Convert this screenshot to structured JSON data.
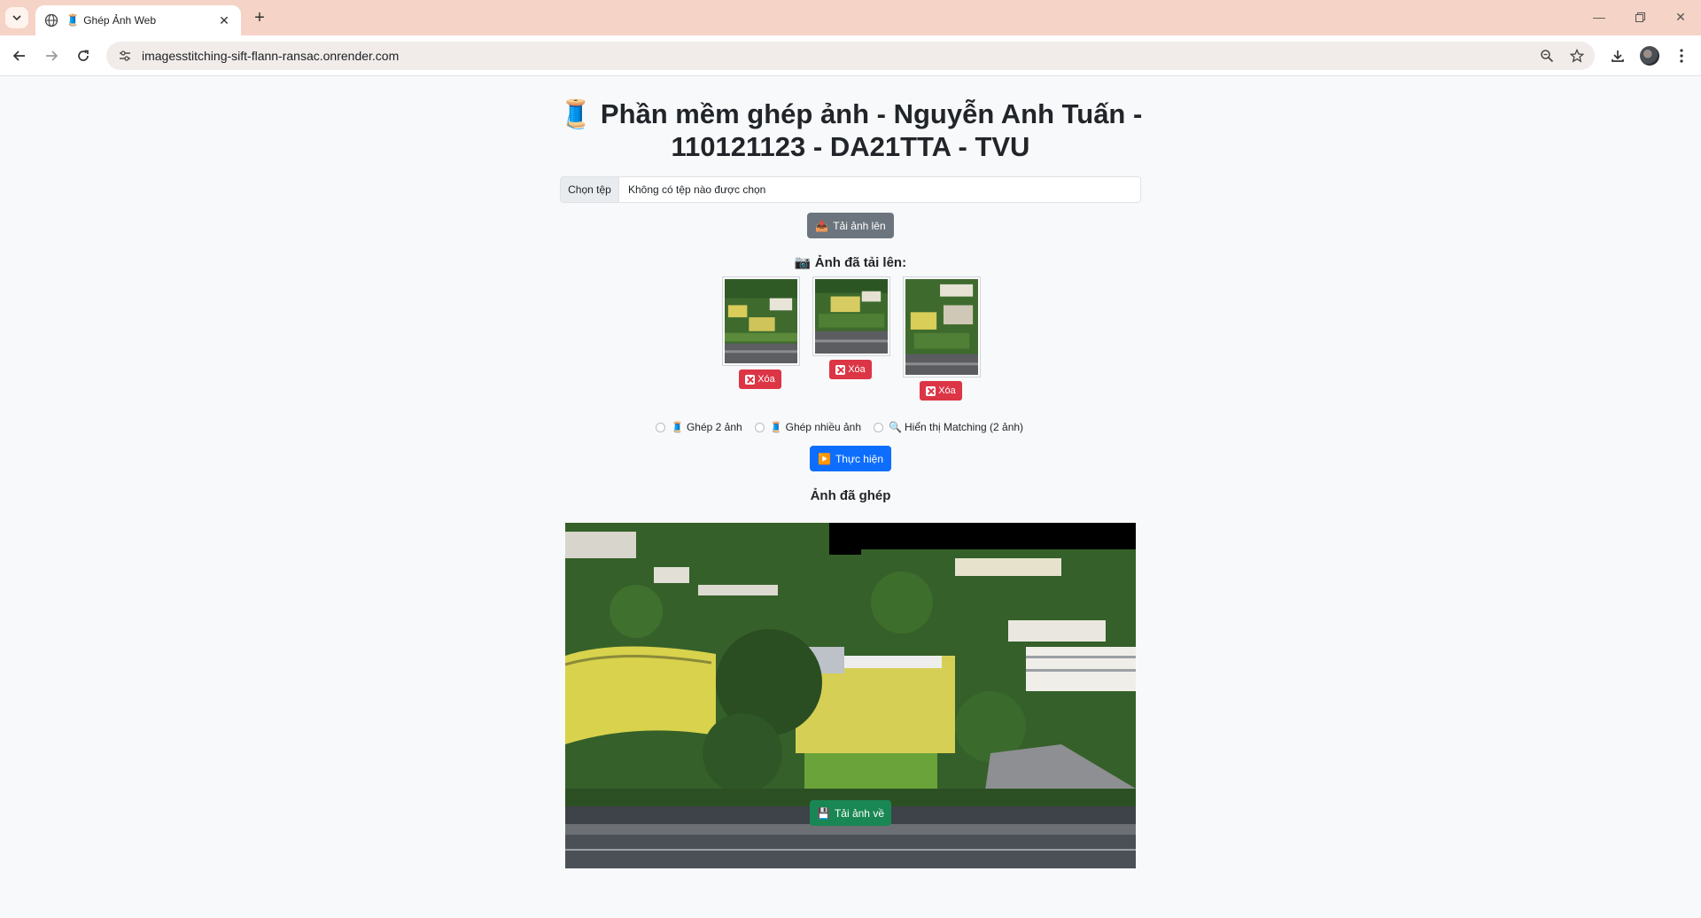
{
  "browser": {
    "tab_title": "Ghép Ảnh Web",
    "tab_favicon": "🧵",
    "url": "imagesstitching-sift-flann-ransac.onrender.com"
  },
  "page": {
    "title_line1": "🧵 Phần mềm ghép ảnh - Nguyễn Anh Tuấn -",
    "title_line2": "110121123 - DA21TTA - TVU",
    "file_input": {
      "button_label": "Chọn tệp",
      "status": "Không có tệp nào được chọn"
    },
    "upload_button": {
      "icon": "📤",
      "label": "Tải ảnh lên"
    },
    "uploaded_heading": "📷 Ảnh đã tải lên:",
    "uploaded_images": [
      {
        "delete_label": "Xóa"
      },
      {
        "delete_label": "Xóa"
      },
      {
        "delete_label": "Xóa"
      }
    ],
    "modes": [
      {
        "icon": "🧵",
        "label": "Ghép 2 ảnh",
        "checked": false
      },
      {
        "icon": "🧵",
        "label": "Ghép nhiều ảnh",
        "checked": false
      },
      {
        "icon": "🔍",
        "label": "Hiển thị Matching (2 ảnh)",
        "checked": false
      }
    ],
    "run_button": {
      "icon": "▶️",
      "label": "Thực hiện"
    },
    "result_heading": "Ảnh đã ghép",
    "download_button": {
      "icon": "💾",
      "label": "Tải ảnh về"
    }
  },
  "colors": {
    "tabbar": "#f6d3c7",
    "btn_secondary": "#6c757d",
    "btn_primary": "#0d6efd",
    "btn_success": "#198754",
    "btn_danger": "#dc3545"
  }
}
